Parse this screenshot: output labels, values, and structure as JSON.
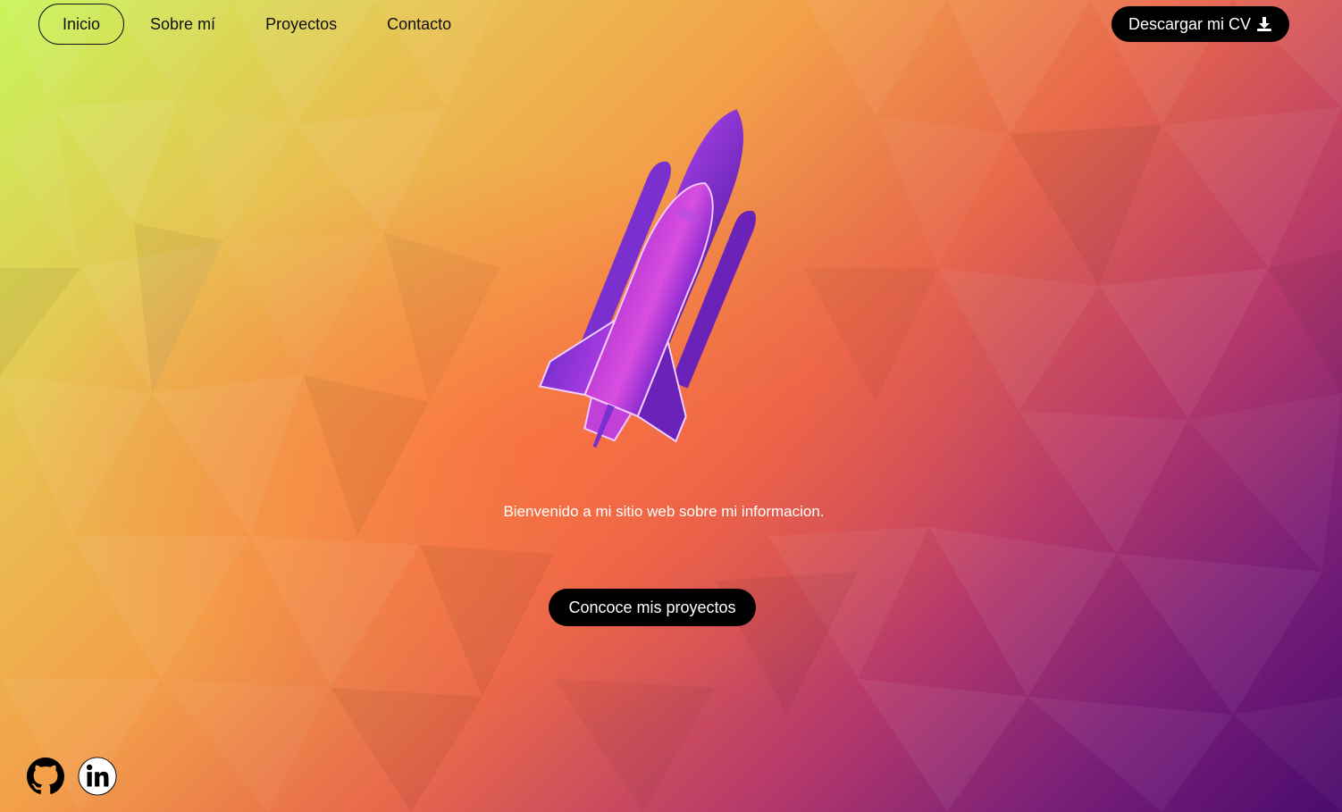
{
  "nav": {
    "items": [
      {
        "label": "Inicio",
        "active": true
      },
      {
        "label": "Sobre mí",
        "active": false
      },
      {
        "label": "Proyectos",
        "active": false
      },
      {
        "label": "Contacto",
        "active": false
      }
    ]
  },
  "header": {
    "cv_button_label": "Descargar mi CV",
    "cv_icon": "download-icon"
  },
  "hero": {
    "illustration": "rocket-illustration",
    "welcome_text": "Bienvenido a mi sitio web sobre mi informacion.",
    "projects_button_label": "Concoce mis proyectos"
  },
  "social": {
    "icons": [
      "github-icon",
      "linkedin-icon"
    ]
  },
  "colors": {
    "background_start": "#c8f55a",
    "background_mid": "#f3a049",
    "background_end": "#4a0b6c",
    "rocket": "#8a2bd0",
    "button": "#000000"
  }
}
